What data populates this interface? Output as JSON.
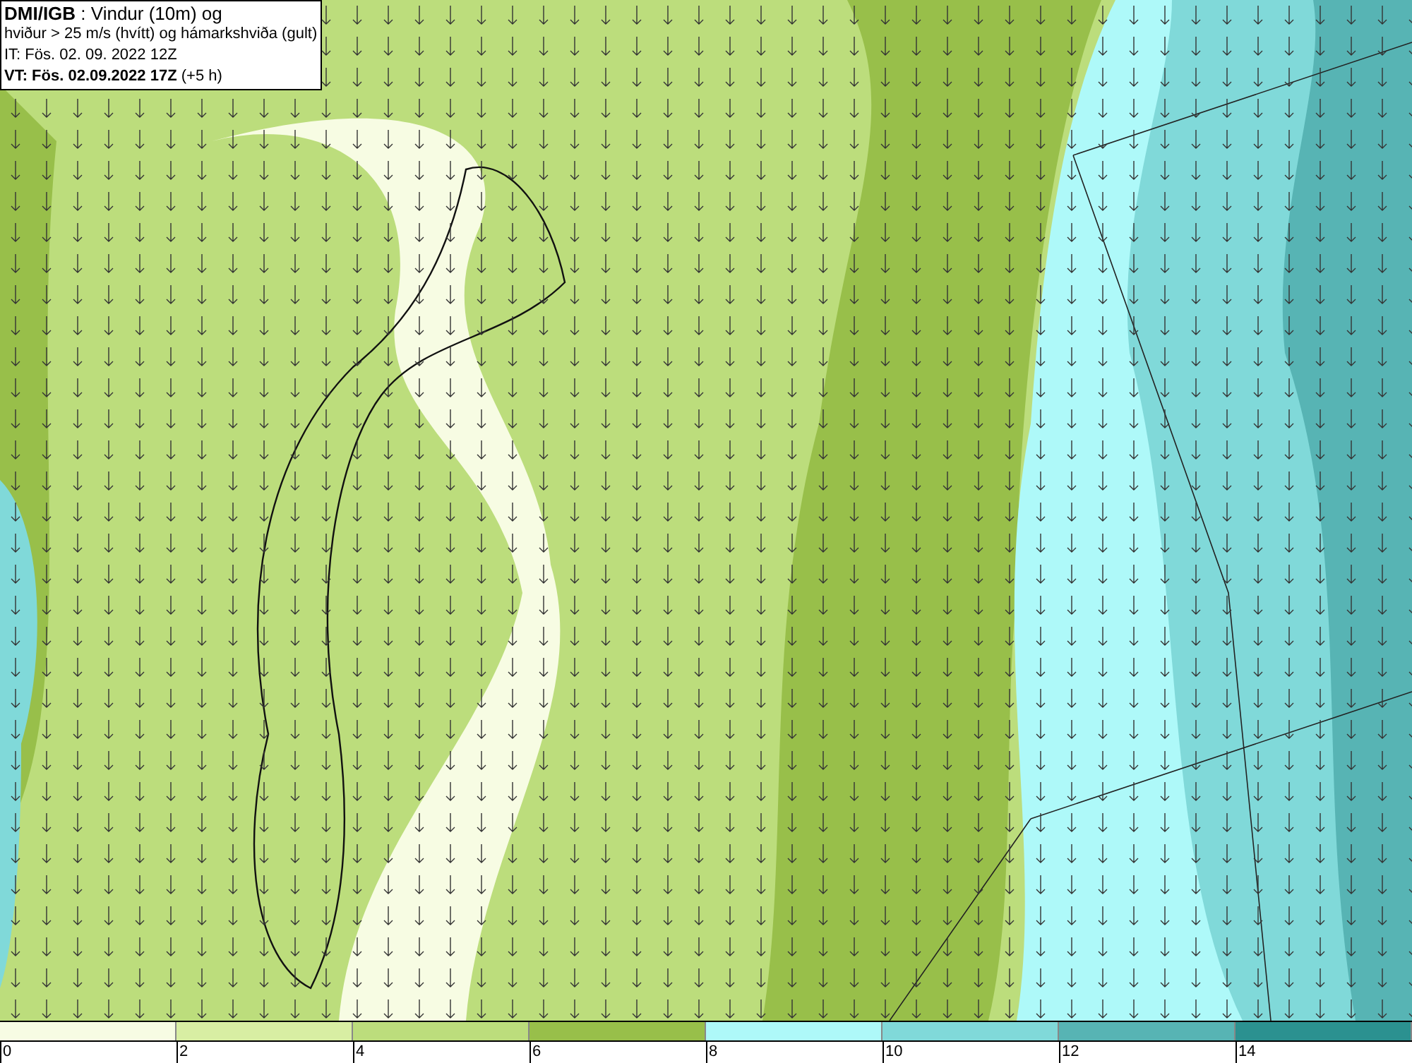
{
  "info_box": {
    "lines": [
      "**DMI/IGB** : Vindur (10m) og",
      "hviður > 25 m/s (hvítt) og hámarkshviða (gult)",
      "IT: Fös. 02. 09. 2022 12Z",
      "**VT: Fös. 02.09.2022 17Z** (+5 h)"
    ]
  },
  "legend": {
    "bins": [
      {
        "color": "#f7fce3"
      },
      {
        "color": "#d8eea3"
      },
      {
        "color": "#bcdd7c"
      },
      {
        "color": "#98bf4a"
      },
      {
        "color": "#aef9f9"
      },
      {
        "color": "#80d9d9"
      },
      {
        "color": "#57b4b4"
      },
      {
        "color": "#2b9190"
      }
    ],
    "ticks": [
      "0",
      "2",
      "4",
      "6",
      "8",
      "10",
      "12",
      "14"
    ]
  }
}
